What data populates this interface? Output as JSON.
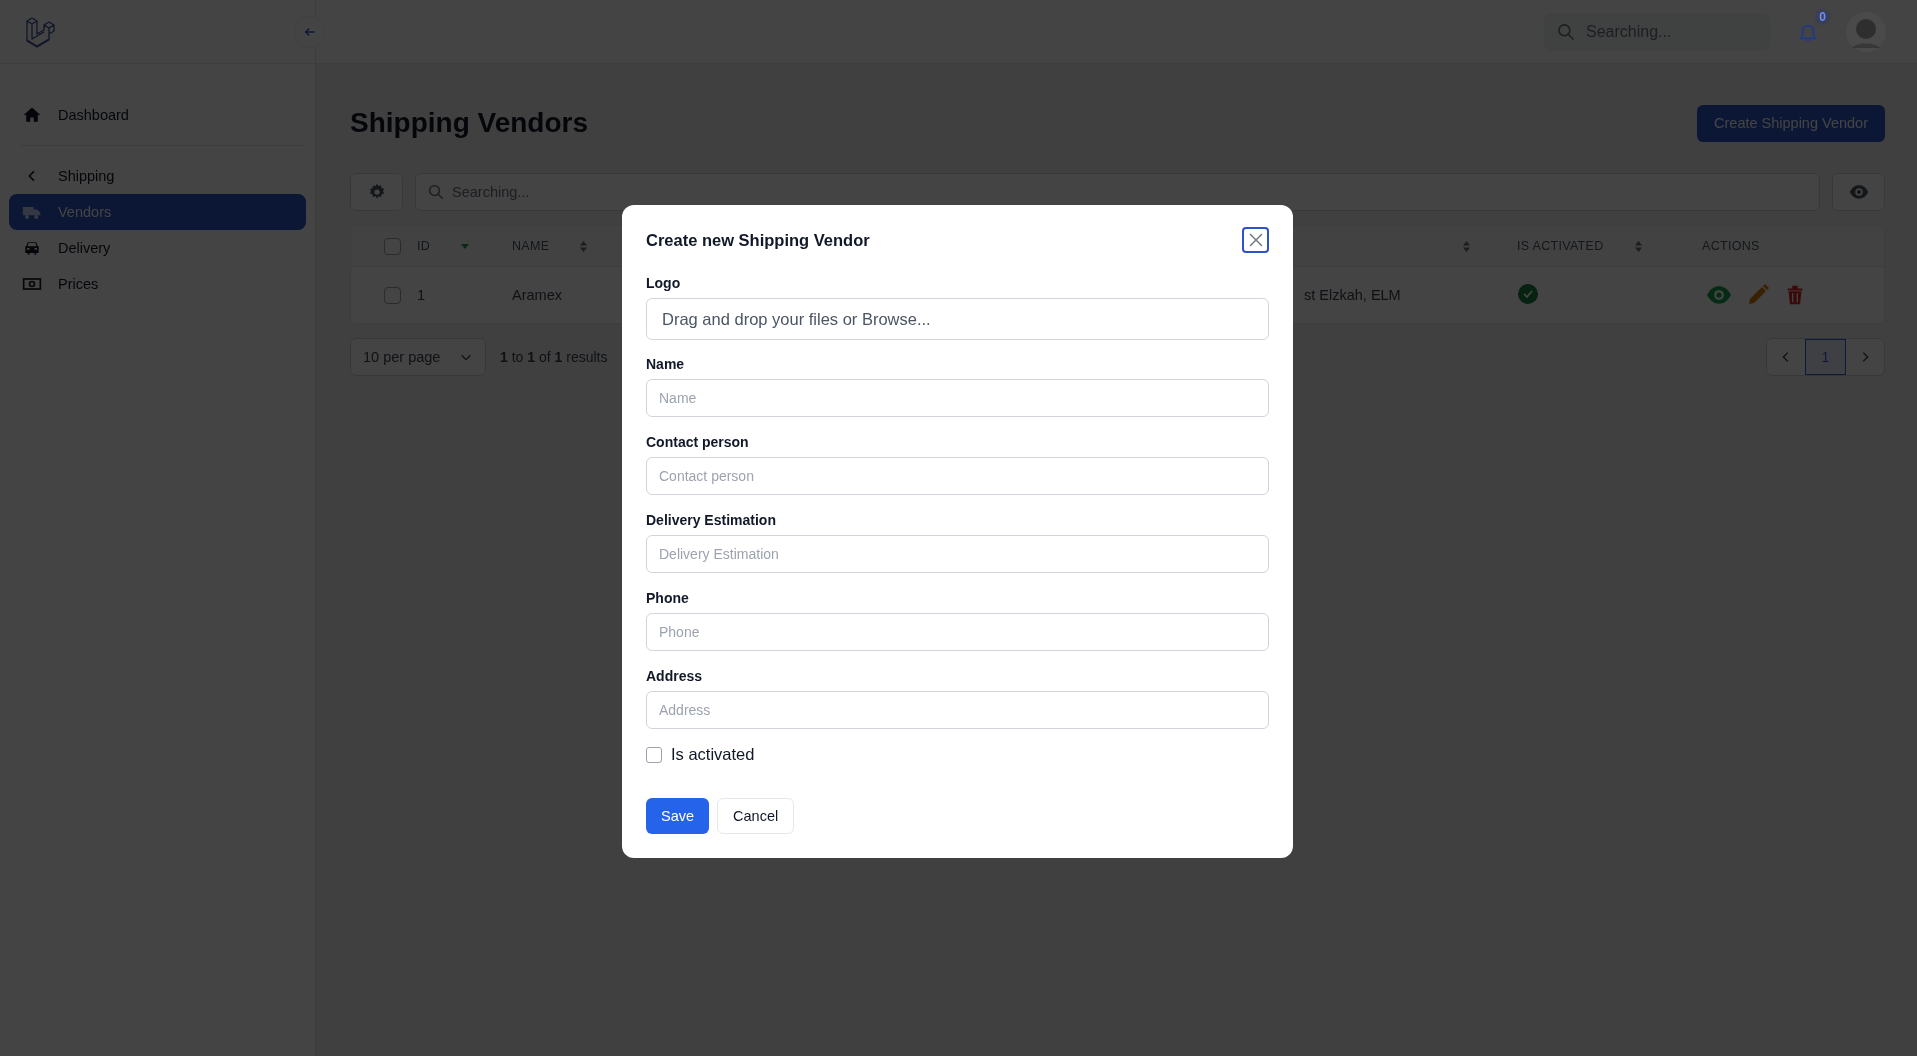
{
  "header": {
    "search_placeholder": "Searching...",
    "notification_count": "0"
  },
  "sidebar": {
    "items": [
      {
        "kind": "link",
        "label": "Dashboard",
        "selected": false
      },
      {
        "kind": "group",
        "label": "Shipping",
        "expanded": true,
        "children": [
          {
            "label": "Vendors",
            "selected": true
          },
          {
            "label": "Delivery",
            "selected": false
          },
          {
            "label": "Prices",
            "selected": false
          }
        ]
      }
    ]
  },
  "page": {
    "title": "Shipping Vendors",
    "create_button": "Create Shipping Vendor"
  },
  "table": {
    "search_placeholder": "Searching...",
    "all_selected": false,
    "columns": [
      {
        "kind": "text",
        "label": "ID",
        "sorted": true
      },
      {
        "kind": "text",
        "label": "NAME",
        "sorted": false
      },
      {
        "kind": "text",
        "sorted": false
      },
      {
        "kind": "status",
        "label": "IS ACTIVATED",
        "sorted": false
      },
      {
        "kind": "actions",
        "label": "ACTIONS"
      }
    ],
    "rows": [
      {
        "selected": false,
        "cells": [
          "1",
          "Aramex",
          "st Elzkah, ELM"
        ],
        "is_activated": true
      }
    ]
  },
  "pagination": {
    "per_page": "10 per page",
    "summary": "**1** to **1** of **1** results",
    "pages": [
      {
        "label": "1",
        "selected": true
      }
    ]
  },
  "dialog": {
    "title": "Create new Shipping Vendor",
    "fields": [
      {
        "kind": "file",
        "label": "Logo",
        "placeholder": "Drag and drop your files or Browse..."
      },
      {
        "kind": "text",
        "label": "Name",
        "placeholder": "Name"
      },
      {
        "kind": "text",
        "label": "Contact person",
        "placeholder": "Contact person"
      },
      {
        "kind": "text",
        "label": "Delivery Estimation",
        "placeholder": "Delivery Estimation"
      },
      {
        "kind": "text",
        "label": "Phone",
        "placeholder": "Phone"
      },
      {
        "kind": "text",
        "label": "Address",
        "placeholder": "Address"
      }
    ],
    "checkbox": {
      "label": "Is activated",
      "checked": false
    },
    "buttons": [
      {
        "kind": "primary",
        "label": "Save"
      },
      {
        "kind": "secondary",
        "label": "Cancel"
      }
    ]
  }
}
